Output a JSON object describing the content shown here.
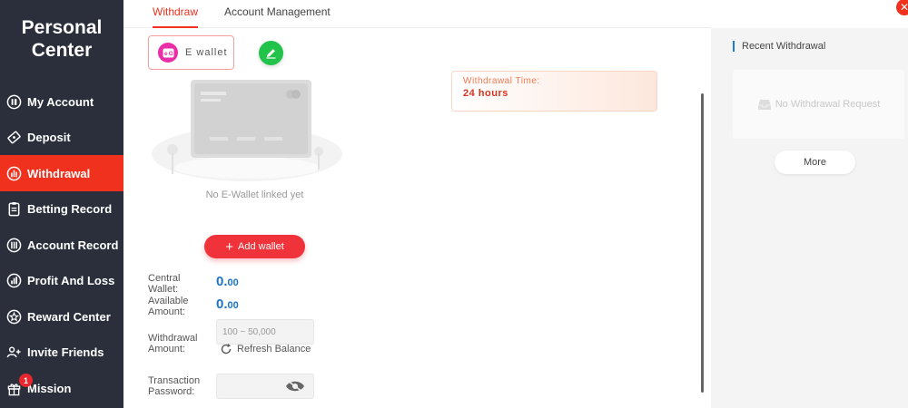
{
  "sidebar": {
    "title": "Personal\nCenter",
    "items": [
      {
        "label": "My Account",
        "icon": "account-icon",
        "active": false
      },
      {
        "label": "Deposit",
        "icon": "deposit-icon",
        "active": false
      },
      {
        "label": "Withdrawal",
        "icon": "withdrawal-icon",
        "active": true
      },
      {
        "label": "Betting Record",
        "icon": "betting-record-icon",
        "active": false
      },
      {
        "label": "Account Record",
        "icon": "account-record-icon",
        "active": false
      },
      {
        "label": "Profit And Loss",
        "icon": "profit-loss-icon",
        "active": false
      },
      {
        "label": "Reward Center",
        "icon": "reward-icon",
        "active": false
      },
      {
        "label": "Invite Friends",
        "icon": "invite-icon",
        "active": false
      },
      {
        "label": "Mission",
        "icon": "gift-icon",
        "active": false,
        "badge": "1"
      }
    ]
  },
  "tabs": [
    {
      "label": "Withdraw",
      "active": true
    },
    {
      "label": "Account Management",
      "active": false
    }
  ],
  "wallet": {
    "ewallet_label": "E wallet",
    "empty_text": "No E-Wallet linked yet",
    "add_label": "Add wallet"
  },
  "form": {
    "central_label": "Central\nWallet:",
    "central_value": "0.",
    "central_decimals": "00",
    "available_label": "Available\nAmount:",
    "available_value": "0.",
    "available_decimals": "00",
    "withdrawal_label": "Withdrawal\nAmount:",
    "withdrawal_placeholder": "100 ~ 50,000",
    "refresh_label": "Refresh Balance",
    "password_label": "Transaction\nPassword:"
  },
  "withdrawal_time": {
    "label": "Withdrawal Time:",
    "value": "24 hours"
  },
  "recent": {
    "title": "Recent Withdrawal",
    "empty": "No Withdrawal Request",
    "more": "More"
  },
  "colors": {
    "accent": "#f0311e",
    "sidebar_bg": "#2b2f3b",
    "amount_blue": "#1b74c8",
    "ewallet_pink": "#ea2ea8",
    "edit_green": "#22c34a"
  }
}
